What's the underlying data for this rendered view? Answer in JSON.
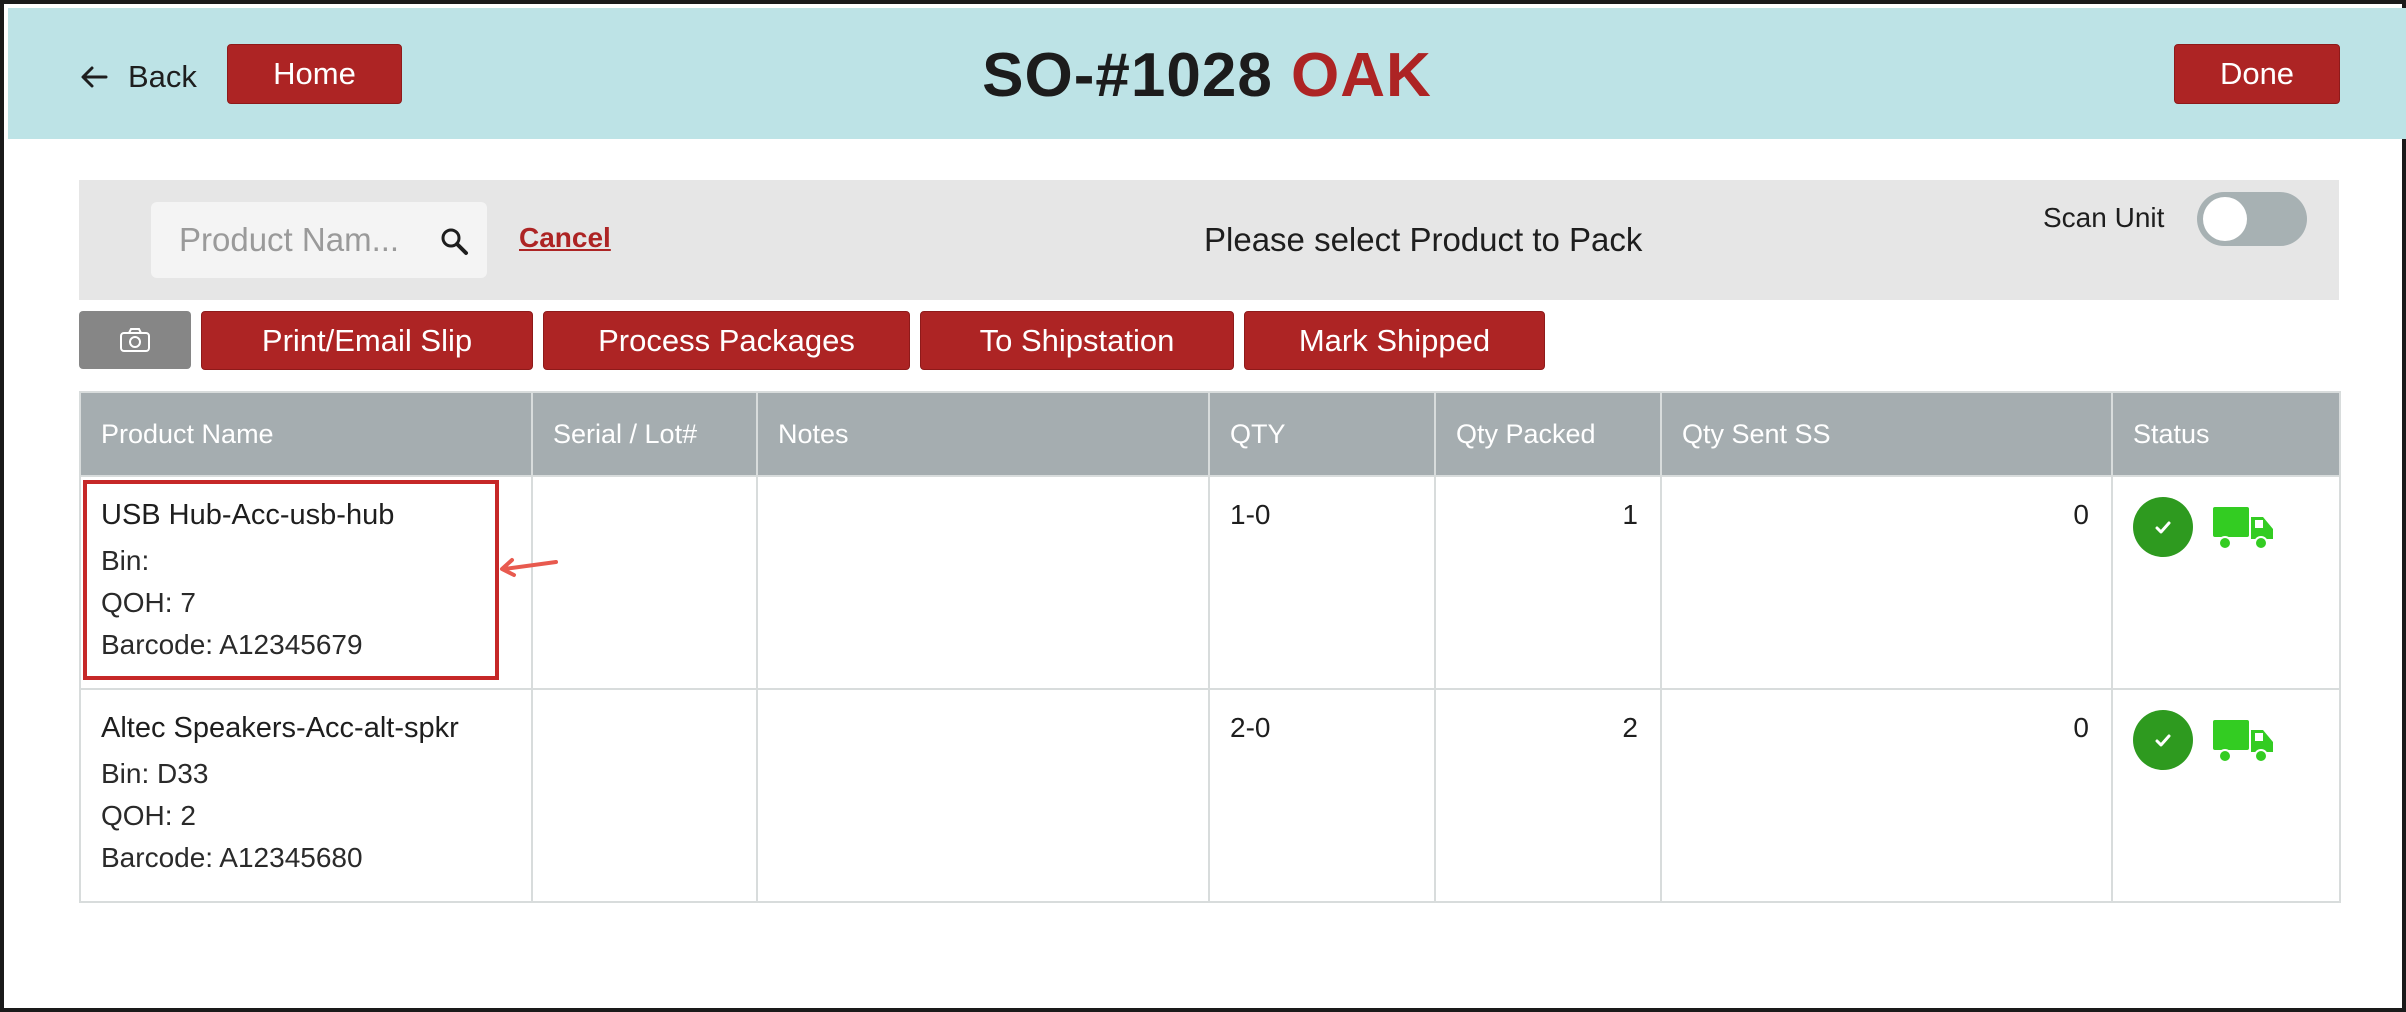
{
  "header": {
    "back_label": "Back",
    "home_label": "Home",
    "order_id": "SO-#1028",
    "location": "OAK",
    "done_label": "Done"
  },
  "search": {
    "placeholder": "Product Nam...",
    "cancel_label": "Cancel",
    "prompt": "Please select Product to Pack",
    "scan_unit_label": "Scan Unit",
    "scan_unit_on": false
  },
  "actions": {
    "print_email": "Print/Email Slip",
    "process_packages": "Process Packages",
    "to_shipstation": "To Shipstation",
    "mark_shipped": "Mark Shipped"
  },
  "table": {
    "columns": [
      "Product Name",
      "Serial / Lot#",
      "Notes",
      "QTY",
      "Qty Packed",
      "Qty Sent SS",
      "Status"
    ],
    "rows": [
      {
        "name": "USB Hub-Acc-usb-hub",
        "bin": "Bin:",
        "qoh": "QOH: 7",
        "barcode": "Barcode: A12345679",
        "serial": "",
        "notes": "",
        "qty": "1-0",
        "packed": "1",
        "sent_ss": "0"
      },
      {
        "name": "Altec Speakers-Acc-alt-spkr",
        "bin": "Bin: D33",
        "qoh": "QOH: 2",
        "barcode": "Barcode: A12345680",
        "serial": "",
        "notes": "",
        "qty": "2-0",
        "packed": "2",
        "sent_ss": "0"
      }
    ]
  },
  "colors": {
    "header_bg": "#bde3e6",
    "accent_red": "#ad2424",
    "status_green": "#2e9a1f",
    "truck_green": "#33cc22",
    "table_header": "#a5adb0"
  },
  "icons": [
    "back-arrow-icon",
    "search-icon",
    "camera-icon",
    "check-circle-icon",
    "truck-icon"
  ]
}
